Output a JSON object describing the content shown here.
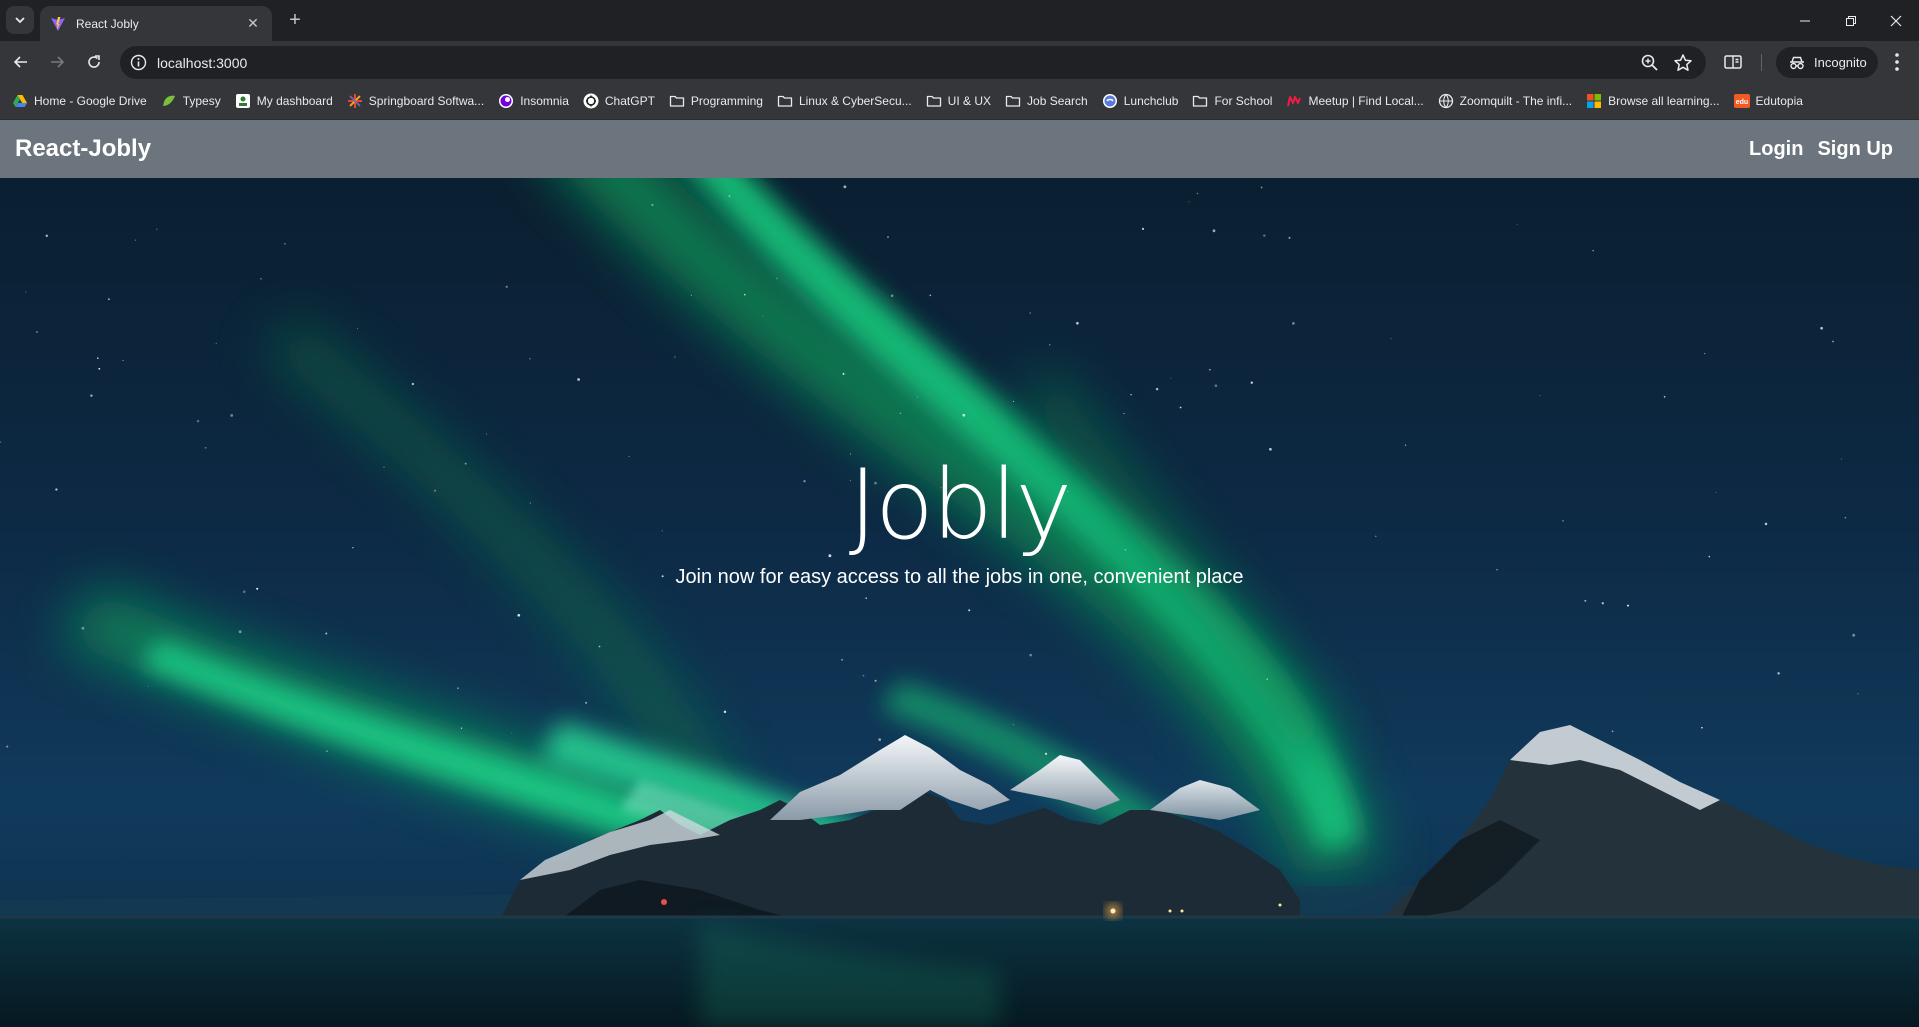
{
  "browser": {
    "tab_title": "React Jobly",
    "url": "localhost:3000",
    "incognito_label": "Incognito",
    "bookmarks": [
      {
        "label": "Home - Google Drive",
        "icon": "google-drive-icon"
      },
      {
        "label": "Typesy",
        "icon": "typesy-icon"
      },
      {
        "label": "My dashboard",
        "icon": "dashboard-icon"
      },
      {
        "label": "Springboard Softwa...",
        "icon": "springboard-icon"
      },
      {
        "label": "Insomnia",
        "icon": "insomnia-icon"
      },
      {
        "label": "ChatGPT",
        "icon": "chatgpt-icon"
      },
      {
        "label": "Programming",
        "icon": "folder-icon"
      },
      {
        "label": "Linux & CyberSecu...",
        "icon": "folder-icon"
      },
      {
        "label": "UI & UX",
        "icon": "folder-icon"
      },
      {
        "label": "Job Search",
        "icon": "folder-icon"
      },
      {
        "label": "Lunchclub",
        "icon": "lunchclub-icon"
      },
      {
        "label": "For School",
        "icon": "folder-icon"
      },
      {
        "label": "Meetup | Find Local...",
        "icon": "meetup-icon"
      },
      {
        "label": "Zoomquilt - The infi...",
        "icon": "globe-icon"
      },
      {
        "label": "Browse all learning...",
        "icon": "microsoft-icon"
      },
      {
        "label": "Edutopia",
        "icon": "edutopia-icon"
      }
    ]
  },
  "navbar": {
    "brand": "React-Jobly",
    "login": "Login",
    "signup": "Sign Up"
  },
  "hero": {
    "title": "Jobly",
    "subtitle": "Join now for easy access to all the jobs in one, convenient place"
  },
  "colors": {
    "navbar_bg": "#6c757d",
    "sky_dark": "#0c2136",
    "aurora_green": "#17e08a"
  }
}
